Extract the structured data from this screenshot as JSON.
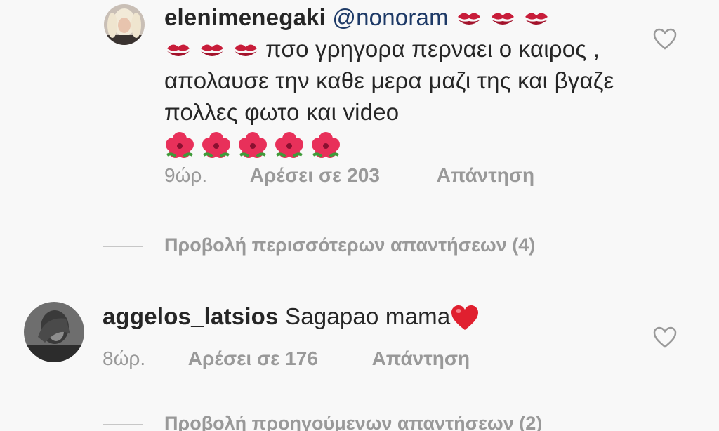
{
  "comments": [
    {
      "username": "elenimenegaki",
      "mention": "@nonoram",
      "lead_emoji": [
        "kiss-mark",
        "kiss-mark",
        "kiss-mark"
      ],
      "line2_emoji": [
        "kiss-mark",
        "kiss-mark",
        "kiss-mark"
      ],
      "text": "πσο γρηγορα περναει ο καιρος , απολαυσε την καθε μερα μαζι της και βγαζε πολλες φωτο και video",
      "trail_emoji": [
        "hibiscus",
        "hibiscus",
        "hibiscus",
        "hibiscus",
        "hibiscus"
      ],
      "time": "9ώρ.",
      "likes": "Αρέσει σε 203",
      "reply": "Απάντηση",
      "view_replies": "Προβολή περισσότερων απαντήσεων (4)"
    },
    {
      "username": "aggelos_latsios",
      "text": "Sagapao mama",
      "trail_emoji": [
        "red-heart"
      ],
      "time": "8ώρ.",
      "likes": "Αρέσει σε 176",
      "reply": "Απάντηση",
      "view_replies": "Προβολή προηγούμενων απαντήσεων (2)"
    }
  ],
  "colors": {
    "username": "#262626",
    "mention": "#1e3a67",
    "meta": "#999999",
    "background": "#f8f8f8"
  }
}
